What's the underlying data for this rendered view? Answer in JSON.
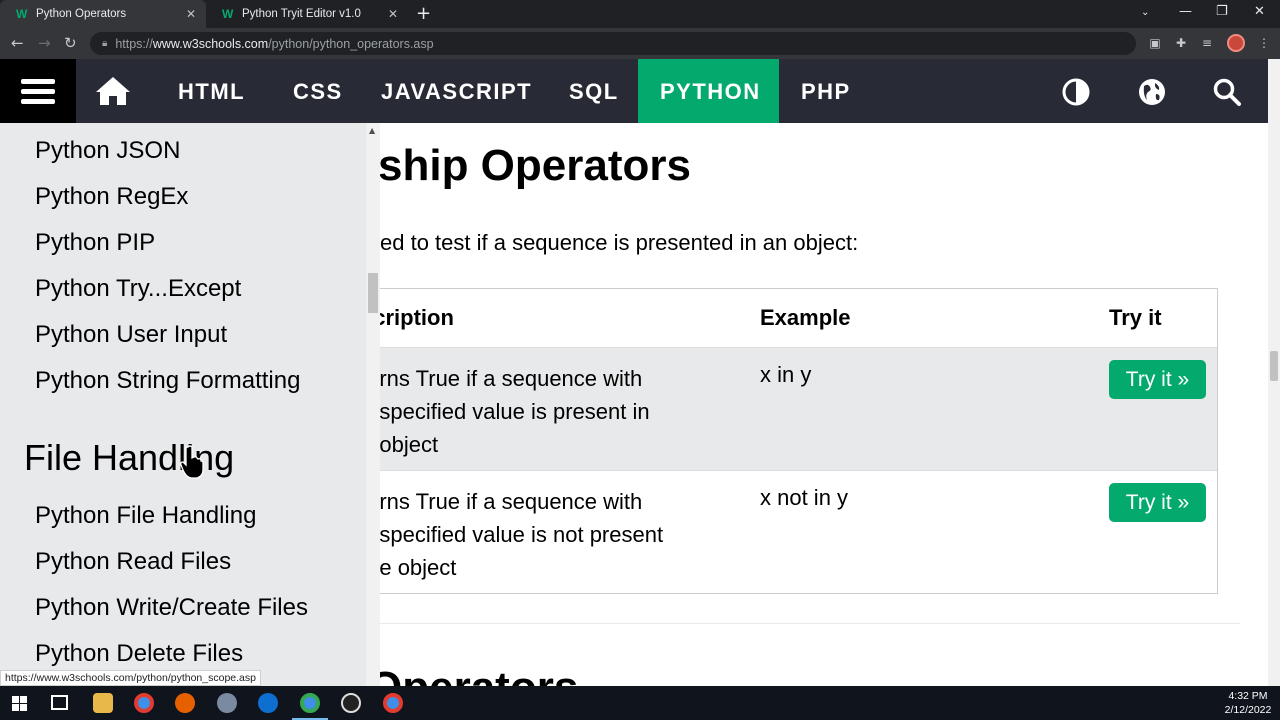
{
  "browser": {
    "tabs": [
      {
        "title": "Python Operators",
        "active": true
      },
      {
        "title": "Python Tryit Editor v1.0",
        "active": false
      }
    ],
    "url_prefix": "https://",
    "url_host": "www.w3schools.com",
    "url_path": "/python/python_operators.asp",
    "status_url": "https://www.w3schools.com/python/python_scope.asp"
  },
  "topnav": {
    "items": [
      "HTML",
      "CSS",
      "JAVASCRIPT",
      "SQL",
      "PYTHON",
      "PHP"
    ],
    "active": "PYTHON",
    "accent": "#04aa6d",
    "background": "#282a35"
  },
  "sidebar": {
    "links_top": [
      "Python JSON",
      "Python RegEx",
      "Python PIP",
      "Python Try...Except",
      "Python User Input",
      "Python String Formatting"
    ],
    "section_heading": "File Handling",
    "links_bottom": [
      "Python File Handling",
      "Python Read Files",
      "Python Write/Create Files",
      "Python Delete Files"
    ]
  },
  "main": {
    "heading": "ship Operators",
    "intro": "ed to test if a sequence is presented in an object:",
    "table": {
      "headers": [
        "scription",
        "Example",
        "Try it"
      ],
      "rows": [
        {
          "desc_lines": [
            "turns True if a sequence with",
            "e specified value is present in",
            "e object"
          ],
          "example": "x in y",
          "button": "Try it »"
        },
        {
          "desc_lines": [
            "turns True if a sequence with",
            "e specified value is not present",
            "the object"
          ],
          "example": "x not in y",
          "button": "Try it »"
        }
      ]
    },
    "next_heading": "Operators"
  },
  "taskbar": {
    "time": "4:32 PM",
    "date": "2/12/2022"
  }
}
